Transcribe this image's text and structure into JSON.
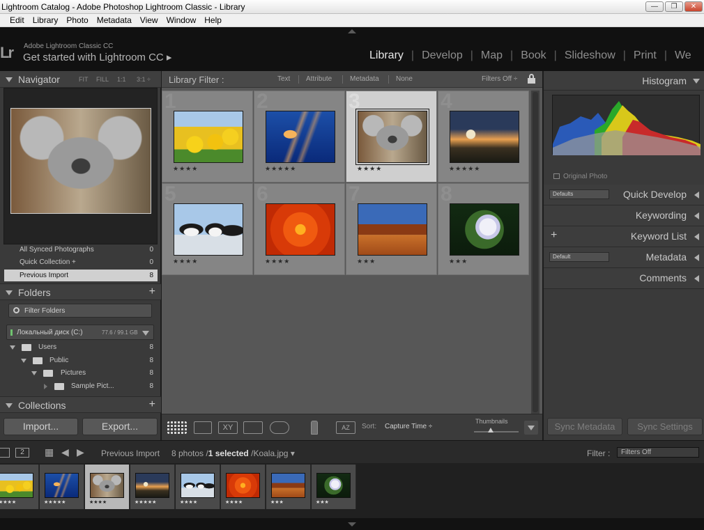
{
  "window": {
    "title": "Lightroom Catalog - Adobe Photoshop Lightroom Classic - Library",
    "controls": [
      "—",
      "❐",
      "✕"
    ]
  },
  "menu": [
    "Edit",
    "Library",
    "Photo",
    "Metadata",
    "View",
    "Window",
    "Help"
  ],
  "identity": {
    "logo": "Lr",
    "brand": "Adobe Lightroom Classic CC",
    "started": "Get started with Lightroom CC ▸"
  },
  "modules": [
    "Library",
    "Develop",
    "Map",
    "Book",
    "Slideshow",
    "Print",
    "We"
  ],
  "active_module": "Library",
  "navigator": {
    "title": "Navigator",
    "zoom": [
      "FIT",
      "FILL",
      "1:1",
      "3:1 ÷"
    ],
    "image": "koala"
  },
  "catalog": [
    {
      "label": "All Synced Photographs",
      "count": "0"
    },
    {
      "label": "Quick Collection +",
      "count": "0"
    },
    {
      "label": "Previous Import",
      "count": "8",
      "selected": true
    }
  ],
  "folders": {
    "title": "Folders",
    "filter_label": "Filter Folders",
    "disk_name": "Локальный диск (C:)",
    "disk_size": "77.6 / 99.1 GB",
    "items": [
      {
        "name": "Users",
        "count": "8"
      },
      {
        "name": "Public",
        "count": "8"
      },
      {
        "name": "Pictures",
        "count": "8"
      },
      {
        "name": "Sample Pict...",
        "count": "8"
      }
    ]
  },
  "collections": {
    "title": "Collections"
  },
  "left_buttons": {
    "import": "Import...",
    "export": "Export..."
  },
  "library_filter": {
    "title": "Library Filter :",
    "options": [
      "Text",
      "Attribute",
      "Metadata",
      "None"
    ],
    "filters_off": "Filters Off ÷"
  },
  "grid": [
    {
      "num": "1",
      "image": "tulips",
      "stars": "★★★★"
    },
    {
      "num": "2",
      "image": "jellyfish",
      "stars": "★★★★★"
    },
    {
      "num": "3",
      "image": "koala",
      "stars": "★★★★",
      "selected": true
    },
    {
      "num": "4",
      "image": "lighthouse",
      "stars": "★★★★★"
    },
    {
      "num": "5",
      "image": "penguins",
      "stars": "★★★★"
    },
    {
      "num": "6",
      "image": "chrysanthemum",
      "stars": "★★★★"
    },
    {
      "num": "7",
      "image": "desert",
      "stars": "★★★"
    },
    {
      "num": "8",
      "image": "hydrangeas",
      "stars": "★★★"
    }
  ],
  "toolbar": {
    "sort_label": "Sort:",
    "sort_value": "Capture Time ÷",
    "thumbnails": "Thumbnails",
    "thumb_size": 0.3
  },
  "right_panel": {
    "histogram": "Histogram",
    "original_photo": "Original Photo",
    "quick_develop_preset": "Defaults",
    "quick_develop": "Quick Develop",
    "keywording": "Keywording",
    "keyword_list": "Keyword List",
    "metadata_preset": "Default",
    "metadata": "Metadata",
    "comments": "Comments",
    "sync_metadata": "Sync Metadata",
    "sync_settings": "Sync Settings"
  },
  "filmstrip": {
    "view_num": "2",
    "source": "Previous Import",
    "photos_count": "8 photos /",
    "selected": "1 selected",
    "filename": "/Koala.jpg ▾",
    "filter_label": "Filter :",
    "filter_value": "Filters Off",
    "stars": [
      "★★★★",
      "★★★★★",
      "★★★★",
      "★★★★★",
      "★★★★",
      "★★★★",
      "★★★",
      "★★★"
    ]
  },
  "colors": {
    "accent": "#e6e6e6",
    "panel_bg": "#3a3a3a",
    "grid_bg": "#575757",
    "cell_bg": "#858585",
    "selected_cell": "#cfcfcf"
  }
}
